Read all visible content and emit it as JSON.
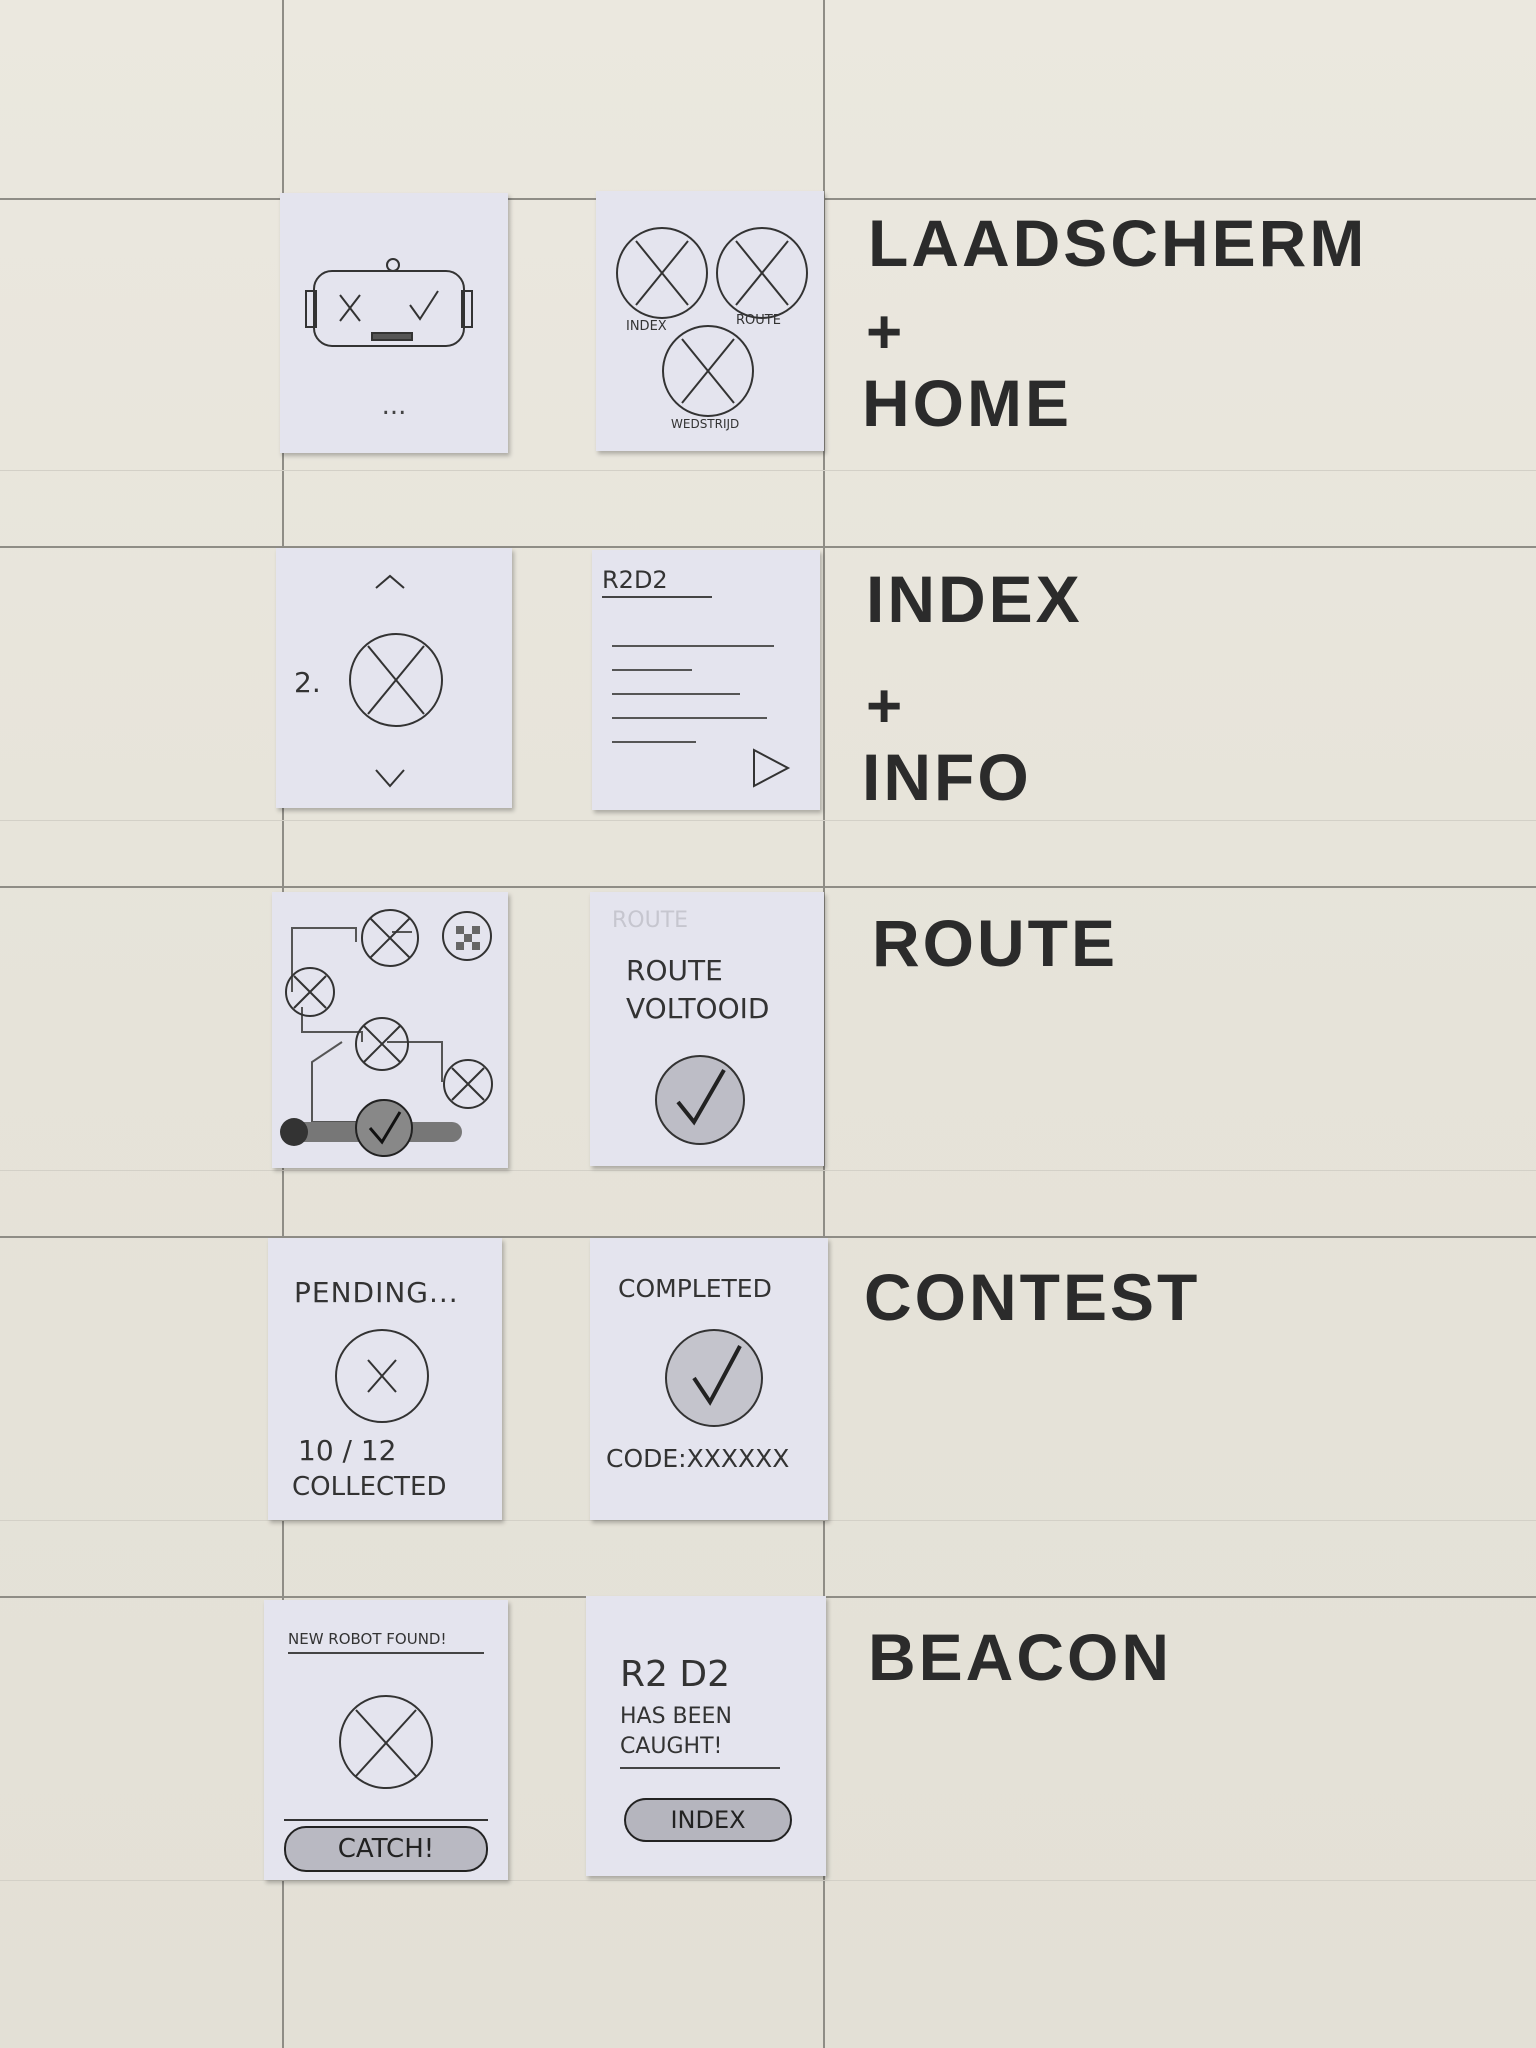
{
  "sections": [
    {
      "id": "laadscherm",
      "label_lines": [
        "LAADSCHERM",
        "+",
        "HOME"
      ]
    },
    {
      "id": "index",
      "label_lines": [
        "INDEX",
        "+",
        "INFO"
      ]
    },
    {
      "id": "route",
      "label_lines": [
        "ROUTE"
      ]
    },
    {
      "id": "contest",
      "label_lines": [
        "CONTEST"
      ]
    },
    {
      "id": "beacon",
      "label_lines": [
        "BEACON"
      ]
    }
  ],
  "cards": {
    "home": {
      "circle_labels": [
        "INDEX",
        "ROUTE",
        "WEDSTRIJD"
      ]
    },
    "loading": {
      "dots": "..."
    },
    "index": {
      "number": "2."
    },
    "info": {
      "title": "R2D2"
    },
    "route_done": {
      "faded_title": "ROUTE",
      "line1": "ROUTE",
      "line2": "VOLTOOID"
    },
    "contest_pending": {
      "title": "PENDING...",
      "count": "10 / 12",
      "collected": "COLLECTED"
    },
    "contest_completed": {
      "title": "COMPLETED",
      "code": "CODE:XXXXXX"
    },
    "beacon_found": {
      "title": "NEW ROBOT FOUND!",
      "button": "CATCH!"
    },
    "beacon_caught": {
      "name": "R2 D2",
      "line1": "HAS BEEN",
      "line2": "CAUGHT!",
      "button": "INDEX"
    }
  },
  "colors": {
    "paper": "#e9e6dc",
    "card": "#e4e4ee",
    "ink": "#2b2b2b",
    "pencil": "#3a3a3a"
  }
}
